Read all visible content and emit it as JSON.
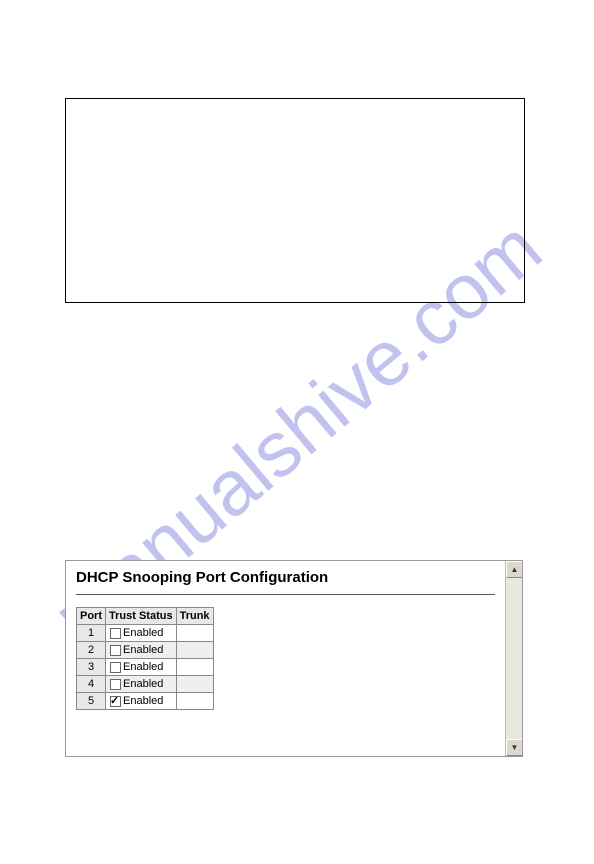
{
  "watermark": "manualshive.com",
  "panel": {
    "title": "DHCP Snooping Port Configuration",
    "columns": {
      "port": "Port",
      "trust": "Trust Status",
      "trunk": "Trunk"
    },
    "enabled_label": "Enabled",
    "rows": [
      {
        "port": "1",
        "checked": false,
        "trunk": ""
      },
      {
        "port": "2",
        "checked": false,
        "trunk": ""
      },
      {
        "port": "3",
        "checked": false,
        "trunk": ""
      },
      {
        "port": "4",
        "checked": false,
        "trunk": ""
      },
      {
        "port": "5",
        "checked": true,
        "trunk": ""
      }
    ]
  }
}
